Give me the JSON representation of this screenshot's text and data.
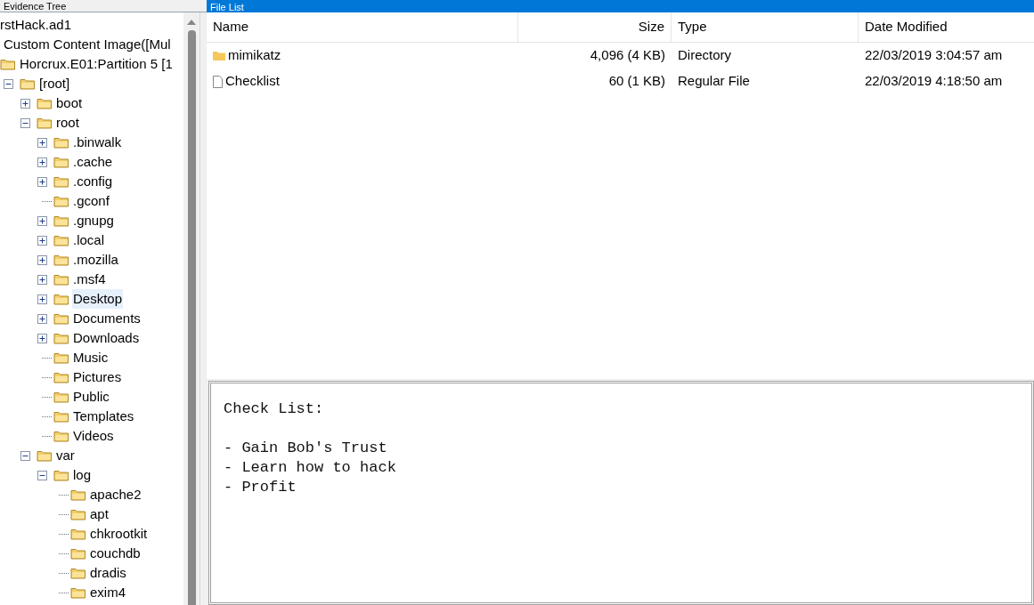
{
  "evidence_tree": {
    "title": "Evidence Tree",
    "top_rows": [
      {
        "kind": "image_file",
        "label": "rstHack.ad1"
      },
      {
        "kind": "content_image",
        "label": "Custom Content Image([Mul"
      },
      {
        "kind": "partition",
        "label": "Horcrux.E01:Partition 5 [1"
      }
    ],
    "nodes": [
      {
        "label": "[root]",
        "expanded": true,
        "selected": false,
        "children": [
          {
            "label": "boot",
            "expanded": false,
            "selected": false
          },
          {
            "label": "root",
            "expanded": true,
            "selected": false,
            "children": [
              {
                "label": ".binwalk",
                "expanded": false,
                "selected": false
              },
              {
                "label": ".cache",
                "expanded": false,
                "selected": false
              },
              {
                "label": ".config",
                "expanded": false,
                "selected": false
              },
              {
                "label": ".gconf",
                "selected": false
              },
              {
                "label": ".gnupg",
                "expanded": false,
                "selected": false
              },
              {
                "label": ".local",
                "expanded": false,
                "selected": false
              },
              {
                "label": ".mozilla",
                "expanded": false,
                "selected": false
              },
              {
                "label": ".msf4",
                "expanded": false,
                "selected": false
              },
              {
                "label": "Desktop",
                "expanded": false,
                "selected": true
              },
              {
                "label": "Documents",
                "expanded": false,
                "selected": false
              },
              {
                "label": "Downloads",
                "expanded": false,
                "selected": false
              },
              {
                "label": "Music",
                "selected": false
              },
              {
                "label": "Pictures",
                "selected": false
              },
              {
                "label": "Public",
                "selected": false
              },
              {
                "label": "Templates",
                "selected": false
              },
              {
                "label": "Videos",
                "selected": false
              }
            ]
          },
          {
            "label": "var",
            "expanded": true,
            "selected": false,
            "children": [
              {
                "label": "log",
                "expanded": true,
                "selected": false,
                "children": [
                  {
                    "label": "apache2",
                    "selected": false
                  },
                  {
                    "label": "apt",
                    "selected": false
                  },
                  {
                    "label": "chkrootkit",
                    "selected": false
                  },
                  {
                    "label": "couchdb",
                    "selected": false
                  },
                  {
                    "label": "dradis",
                    "selected": false
                  },
                  {
                    "label": "exim4",
                    "selected": false
                  }
                ]
              }
            ]
          }
        ]
      }
    ]
  },
  "file_list": {
    "title": "File List",
    "columns": [
      "Name",
      "Size",
      "Type",
      "Date Modified"
    ],
    "rows": [
      {
        "kind": "folder",
        "name": "mimikatz",
        "size": "4,096 (4 KB)",
        "type": "Directory",
        "date": "22/03/2019 3:04:57 am"
      },
      {
        "kind": "file",
        "name": "Checklist",
        "size": "60 (1 KB)",
        "type": "Regular File",
        "date": "22/03/2019 4:18:50 am"
      }
    ]
  },
  "preview": {
    "heading": "Check List:",
    "lines": [
      "- Gain Bob's Trust",
      "- Learn how to hack",
      "- Profit"
    ]
  }
}
